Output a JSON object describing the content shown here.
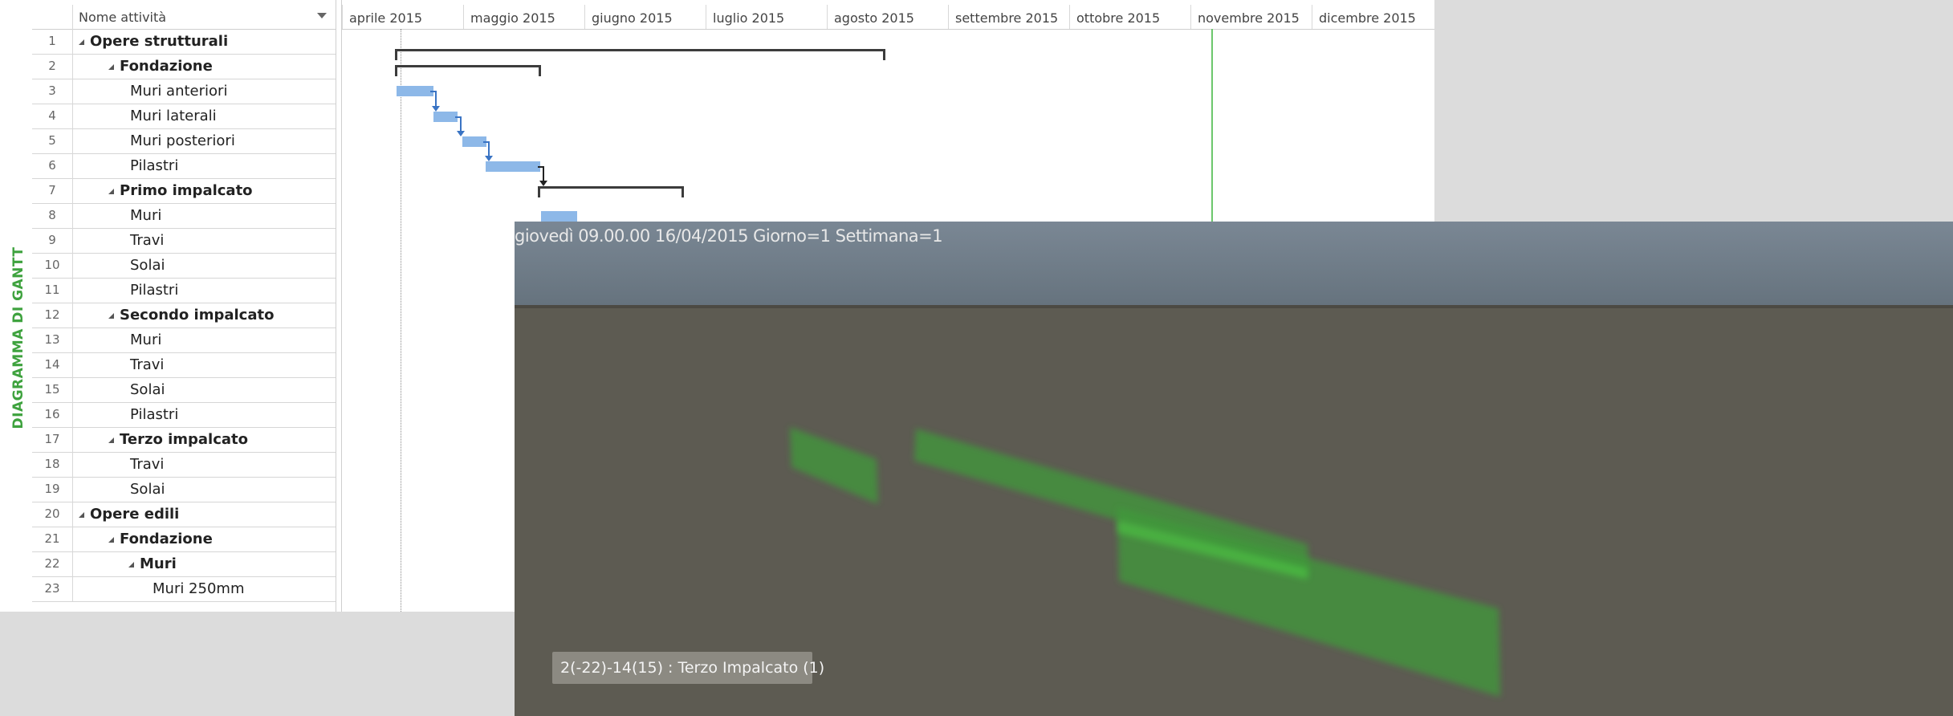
{
  "grid": {
    "header_name": "Nome attività",
    "rows": [
      {
        "num": "1",
        "name": "Opere strutturali",
        "level": 0,
        "summary": true
      },
      {
        "num": "2",
        "name": "Fondazione",
        "level": 1,
        "summary": true
      },
      {
        "num": "3",
        "name": "Muri anteriori",
        "level": 2,
        "summary": false
      },
      {
        "num": "4",
        "name": "Muri laterali",
        "level": 2,
        "summary": false
      },
      {
        "num": "5",
        "name": "Muri posteriori",
        "level": 2,
        "summary": false
      },
      {
        "num": "6",
        "name": "Pilastri",
        "level": 2,
        "summary": false
      },
      {
        "num": "7",
        "name": "Primo impalcato",
        "level": 1,
        "summary": true
      },
      {
        "num": "8",
        "name": "Muri",
        "level": 2,
        "summary": false
      },
      {
        "num": "9",
        "name": "Travi",
        "level": 2,
        "summary": false
      },
      {
        "num": "10",
        "name": "Solai",
        "level": 2,
        "summary": false
      },
      {
        "num": "11",
        "name": "Pilastri",
        "level": 2,
        "summary": false
      },
      {
        "num": "12",
        "name": "Secondo impalcato",
        "level": 1,
        "summary": true
      },
      {
        "num": "13",
        "name": "Muri",
        "level": 2,
        "summary": false
      },
      {
        "num": "14",
        "name": "Travi",
        "level": 2,
        "summary": false
      },
      {
        "num": "15",
        "name": "Solai",
        "level": 2,
        "summary": false
      },
      {
        "num": "16",
        "name": "Pilastri",
        "level": 2,
        "summary": false
      },
      {
        "num": "17",
        "name": "Terzo impalcato",
        "level": 1,
        "summary": true
      },
      {
        "num": "18",
        "name": "Travi",
        "level": 2,
        "summary": false
      },
      {
        "num": "19",
        "name": "Solai",
        "level": 2,
        "summary": false
      },
      {
        "num": "20",
        "name": "Opere edili",
        "level": 0,
        "summary": true
      },
      {
        "num": "21",
        "name": "Fondazione",
        "level": 1,
        "summary": true
      },
      {
        "num": "22",
        "name": "Muri",
        "level": 2,
        "summary": true
      },
      {
        "num": "23",
        "name": "Muri 250mm",
        "level": 3,
        "summary": false
      }
    ]
  },
  "side_label": "DIAGRAMMA DI GANTT",
  "timeline": {
    "months": [
      "aprile 2015",
      "maggio 2015",
      "giugno 2015",
      "luglio 2015",
      "agosto 2015",
      "settembre 2015",
      "ottobre 2015",
      "novembre 2015",
      "dicembre 2015"
    ]
  },
  "viewer": {
    "status_text": "giovedì 09.00.00 16/04/2015 Giorno=1 Settimana=1",
    "info_label": "2(-22)-14(15) : Terzo Impalcato (1)"
  },
  "colors": {
    "task_bar": "#8db8e8",
    "link": "#3a74c4",
    "today_line": "#6cc86c",
    "side_label": "#3ea23e",
    "scene_green": "#3f9a3a"
  }
}
